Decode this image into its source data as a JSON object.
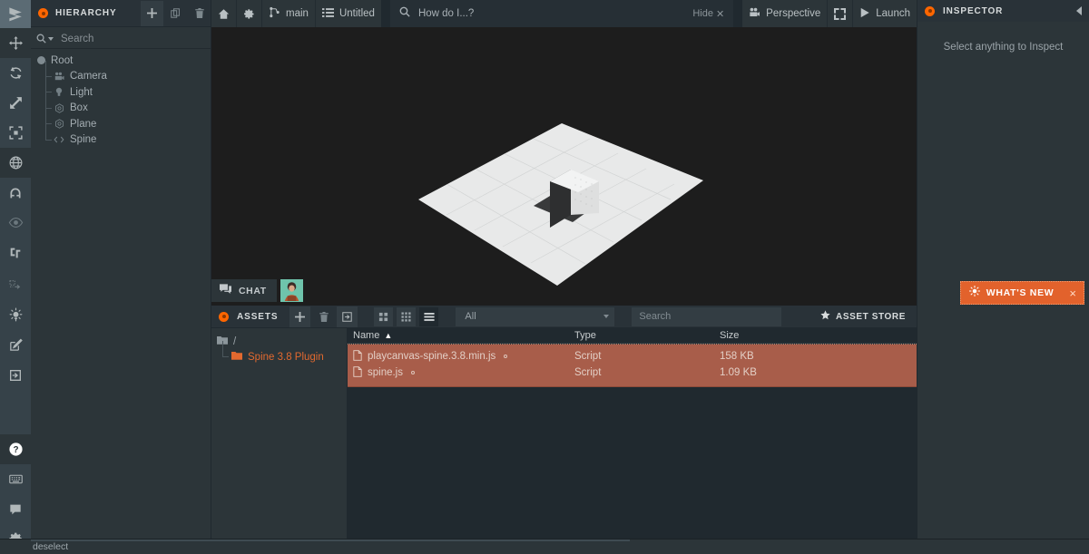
{
  "left_rail": {
    "items": [
      {
        "name": "playcanvas-logo-icon",
        "label": "PlayCanvas"
      },
      {
        "name": "translate-tool-icon",
        "label": "Translate"
      },
      {
        "name": "rotate-tool-icon",
        "label": "Rotate"
      },
      {
        "name": "scale-tool-icon",
        "label": "Scale"
      },
      {
        "name": "focus-tool-icon",
        "label": "Focus"
      },
      {
        "name": "world-space-icon",
        "label": "World / Local space"
      },
      {
        "name": "snap-magnet-icon",
        "label": "Snap"
      },
      {
        "name": "visibility-eye-icon",
        "label": "Toggle visibility"
      },
      {
        "name": "grid-toggle-icon",
        "label": "Toggle grid"
      },
      {
        "name": "history-icon",
        "label": "History"
      },
      {
        "name": "lightmap-icon",
        "label": "Bake lightmaps"
      },
      {
        "name": "edit-icon",
        "label": "Edit"
      },
      {
        "name": "import-icon",
        "label": "Import"
      },
      {
        "name": "help-icon",
        "label": "Help"
      },
      {
        "name": "keyboard-shortcuts-icon",
        "label": "Keyboard shortcuts"
      },
      {
        "name": "feedback-chat-icon",
        "label": "Feedback"
      },
      {
        "name": "settings-gear-icon",
        "label": "Settings"
      }
    ]
  },
  "hierarchy": {
    "title": "HIERARCHY",
    "buttons": [
      {
        "name": "add-entity-button",
        "glyph": "+"
      },
      {
        "name": "duplicate-entity-button",
        "glyph": "copy"
      },
      {
        "name": "delete-entity-button",
        "glyph": "trash"
      }
    ],
    "search": {
      "placeholder": "Search",
      "value": ""
    },
    "tree": [
      {
        "label": "Root",
        "icon": "root-dot-icon",
        "depth": 0
      },
      {
        "label": "Camera",
        "icon": "camera-icon",
        "depth": 1
      },
      {
        "label": "Light",
        "icon": "light-bulb-icon",
        "depth": 1
      },
      {
        "label": "Box",
        "icon": "model-mesh-icon",
        "depth": 1
      },
      {
        "label": "Plane",
        "icon": "model-mesh-icon",
        "depth": 1
      },
      {
        "label": "Spine",
        "icon": "script-code-icon",
        "depth": 1
      }
    ]
  },
  "toolbar": {
    "home_label": "",
    "settings_label": "",
    "branch_label": "main",
    "scene_label": "Untitled",
    "search": {
      "placeholder": "How do I...?",
      "value": ""
    },
    "hide_label": "Hide",
    "camera_label": "Perspective",
    "fullscreen_label": "",
    "launch_label": "Launch"
  },
  "viewport": {
    "chat_label": "CHAT",
    "whats_new_label": "WHAT'S NEW",
    "whats_new_close": "×"
  },
  "assets": {
    "title": "ASSETS",
    "buttons": [
      {
        "name": "add-asset-button",
        "glyph": "+"
      },
      {
        "name": "delete-asset-button",
        "glyph": "trash"
      },
      {
        "name": "duplicate-asset-button",
        "glyph": "dup"
      }
    ],
    "view_modes": [
      {
        "name": "small-grid-view-button",
        "active": false
      },
      {
        "name": "large-grid-view-button",
        "active": false
      },
      {
        "name": "list-view-button",
        "active": true
      }
    ],
    "filter": {
      "value": "All"
    },
    "search": {
      "placeholder": "Search",
      "value": ""
    },
    "store_label": "ASSET STORE",
    "folders": [
      {
        "label": "/",
        "selected": false
      },
      {
        "label": "Spine 3.8 Plugin",
        "selected": true
      }
    ],
    "columns": [
      "Name",
      "Type",
      "Size"
    ],
    "sort_column": "Name",
    "sort_direction": "asc",
    "rows": [
      {
        "name": "playcanvas-spine.3.8.min.js",
        "type": "Script",
        "size": "158 KB",
        "selected": true
      },
      {
        "name": "spine.js",
        "type": "Script",
        "size": "1.09 KB",
        "selected": true
      }
    ]
  },
  "inspector": {
    "title": "INSPECTOR",
    "empty_message": "Select anything to Inspect"
  },
  "statusbar": {
    "message": "deselect"
  },
  "colors": {
    "accent_orange": "#ff6600",
    "banner_orange": "#e2622c",
    "selection_red": "#a85d4a",
    "panel_bg": "#2c3539",
    "app_bg": "#20292f",
    "viewport_bg": "#1d1d1d",
    "rail_bg": "#364249"
  }
}
